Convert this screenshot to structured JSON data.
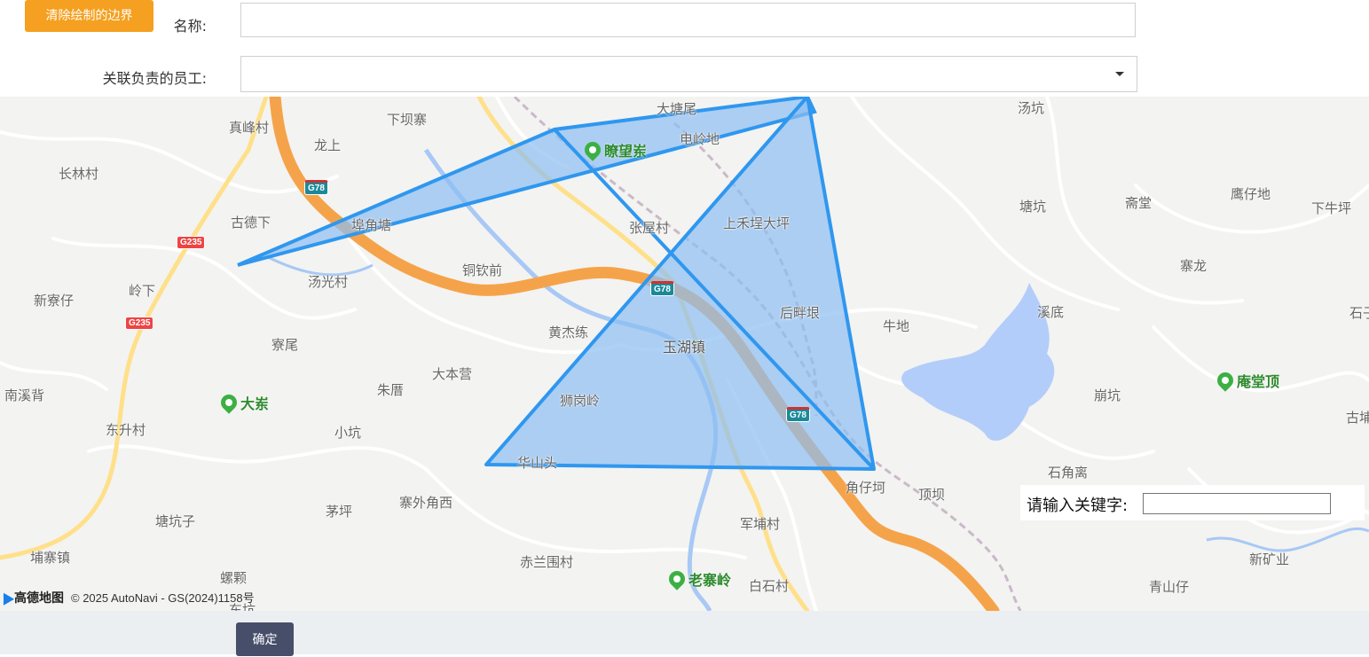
{
  "toolbar": {
    "clear_label": "清除绘制的边界"
  },
  "form": {
    "name_label": "名称:",
    "name_value": "",
    "staff_label": "关联负责的员工:",
    "staff_value": ""
  },
  "map": {
    "road_color": "#f5a34a",
    "polygon_fill": "#8cbdf2",
    "polygon_stroke": "#2f97ef",
    "places": [
      "长林村",
      "真峰村",
      "龙上",
      "下坝寨",
      "大塘尾",
      "电岭地",
      "汤坑",
      "古德下",
      "埠角塘",
      "张屋村",
      "上禾埕大坪",
      "塘坑",
      "斋堂",
      "鹰仔地",
      "下牛坪",
      "新寮仔",
      "岭下",
      "汤光村",
      "铜钦前",
      "寨龙",
      "后畔垠",
      "溪底",
      "牛地",
      "寮尾",
      "黄杰练",
      "玉湖镇",
      "大本营",
      "朱厝",
      "南溪背",
      "狮岗岭",
      "崩坑",
      "东升村",
      "小坑",
      "华山头",
      "角仔坷",
      "顶坝",
      "石角离",
      "茅坪",
      "塘坑子",
      "寨外角西",
      "军埔村",
      "埔寨镇",
      "赤兰围村",
      "新矿业",
      "青山仔",
      "螺颗",
      "白石村",
      "东坑",
      "石子",
      "古埔"
    ],
    "pois": [
      "瞭望岽",
      "大岽",
      "庵堂顶",
      "老寨岭"
    ],
    "highway_badges": [
      "G78",
      "G78",
      "G78",
      "G235",
      "G235"
    ],
    "logo_text": "高德地图",
    "copyright": "© 2025 AutoNavi - GS(2024)1158号",
    "keyword_label": "请输入关键字:",
    "keyword_value": ""
  },
  "footer": {
    "confirm_label": "确定"
  }
}
